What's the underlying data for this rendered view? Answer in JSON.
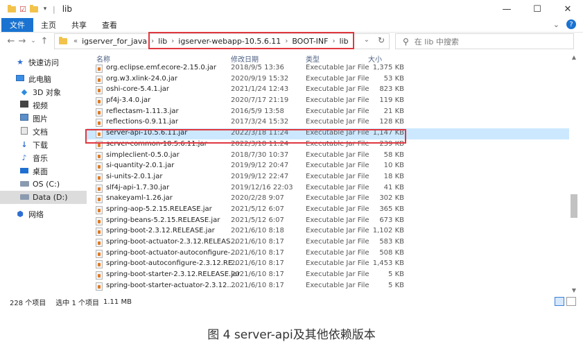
{
  "window": {
    "title": "lib",
    "controls": {
      "minimize": "—",
      "maximize": "☐",
      "close": "✕"
    }
  },
  "ribbon": {
    "tabs": [
      "文件",
      "主页",
      "共享",
      "查看"
    ],
    "help": "?"
  },
  "address": {
    "crumbs": [
      "igserver_for_java",
      "lib",
      "igserver-webapp-10.5.6.11",
      "BOOT-INF",
      "lib"
    ],
    "prefix": "«"
  },
  "search": {
    "placeholder": "在 lib 中搜索"
  },
  "sidebar": {
    "items": [
      {
        "label": "快速访问",
        "icon": "star-icon"
      },
      {
        "label": "此电脑",
        "icon": "computer-icon"
      },
      {
        "label": "3D 对象",
        "icon": "cube-icon"
      },
      {
        "label": "视频",
        "icon": "video-icon"
      },
      {
        "label": "图片",
        "icon": "picture-icon"
      },
      {
        "label": "文档",
        "icon": "document-icon"
      },
      {
        "label": "下载",
        "icon": "download-icon"
      },
      {
        "label": "音乐",
        "icon": "music-icon"
      },
      {
        "label": "桌面",
        "icon": "desktop-icon"
      },
      {
        "label": "OS (C:)",
        "icon": "drive-icon"
      },
      {
        "label": "Data (D:)",
        "icon": "drive-icon"
      },
      {
        "label": "网络",
        "icon": "network-icon"
      }
    ]
  },
  "columns": {
    "name": "名称",
    "date": "修改日期",
    "type": "类型",
    "size": "大小"
  },
  "files": [
    {
      "name": "org.eclipse.emf.ecore-2.15.0.jar",
      "date": "2018/9/5 13:36",
      "type": "Executable Jar File",
      "size": "1,375 KB"
    },
    {
      "name": "org.w3.xlink-24.0.jar",
      "date": "2020/9/19 15:32",
      "type": "Executable Jar File",
      "size": "53 KB"
    },
    {
      "name": "oshi-core-5.4.1.jar",
      "date": "2021/1/24 12:43",
      "type": "Executable Jar File",
      "size": "823 KB"
    },
    {
      "name": "pf4j-3.4.0.jar",
      "date": "2020/7/17 21:19",
      "type": "Executable Jar File",
      "size": "119 KB"
    },
    {
      "name": "reflectasm-1.11.3.jar",
      "date": "2016/5/9 13:58",
      "type": "Executable Jar File",
      "size": "21 KB"
    },
    {
      "name": "reflections-0.9.11.jar",
      "date": "2017/3/24 15:32",
      "type": "Executable Jar File",
      "size": "128 KB"
    },
    {
      "name": "server-api-10.5.6.11.jar",
      "date": "2022/3/18 11:24",
      "type": "Executable Jar File",
      "size": "1,147 KB",
      "selected": true
    },
    {
      "name": "server-common-10.5.6.11.jar",
      "date": "2022/3/18 11:24",
      "type": "Executable Jar File",
      "size": "239 KB"
    },
    {
      "name": "simpleclient-0.5.0.jar",
      "date": "2018/7/30 10:37",
      "type": "Executable Jar File",
      "size": "58 KB"
    },
    {
      "name": "si-quantity-2.0.1.jar",
      "date": "2019/9/12 20:47",
      "type": "Executable Jar File",
      "size": "10 KB"
    },
    {
      "name": "si-units-2.0.1.jar",
      "date": "2019/9/12 22:47",
      "type": "Executable Jar File",
      "size": "18 KB"
    },
    {
      "name": "slf4j-api-1.7.30.jar",
      "date": "2019/12/16 22:03",
      "type": "Executable Jar File",
      "size": "41 KB"
    },
    {
      "name": "snakeyaml-1.26.jar",
      "date": "2020/2/28 9:07",
      "type": "Executable Jar File",
      "size": "302 KB"
    },
    {
      "name": "spring-aop-5.2.15.RELEASE.jar",
      "date": "2021/5/12 6:07",
      "type": "Executable Jar File",
      "size": "365 KB"
    },
    {
      "name": "spring-beans-5.2.15.RELEASE.jar",
      "date": "2021/5/12 6:07",
      "type": "Executable Jar File",
      "size": "673 KB"
    },
    {
      "name": "spring-boot-2.3.12.RELEASE.jar",
      "date": "2021/6/10 8:18",
      "type": "Executable Jar File",
      "size": "1,102 KB"
    },
    {
      "name": "spring-boot-actuator-2.3.12.RELEAS...",
      "date": "2021/6/10 8:17",
      "type": "Executable Jar File",
      "size": "583 KB"
    },
    {
      "name": "spring-boot-actuator-autoconfigure-...",
      "date": "2021/6/10 8:17",
      "type": "Executable Jar File",
      "size": "508 KB"
    },
    {
      "name": "spring-boot-autoconfigure-2.3.12.RE...",
      "date": "2021/6/10 8:17",
      "type": "Executable Jar File",
      "size": "1,453 KB"
    },
    {
      "name": "spring-boot-starter-2.3.12.RELEASE.jar",
      "date": "2021/6/10 8:17",
      "type": "Executable Jar File",
      "size": "5 KB"
    },
    {
      "name": "spring-boot-starter-actuator-2.3.12....",
      "date": "2021/6/10 8:17",
      "type": "Executable Jar File",
      "size": "5 KB"
    }
  ],
  "status": {
    "count": "228 个项目",
    "selected": "选中 1 个项目",
    "size": "1.11 MB"
  },
  "caption": "图 4 server-api及其他依赖版本",
  "colors": {
    "accent": "#1a73d1",
    "highlight": "#e0373f",
    "selection": "#cce8ff"
  }
}
